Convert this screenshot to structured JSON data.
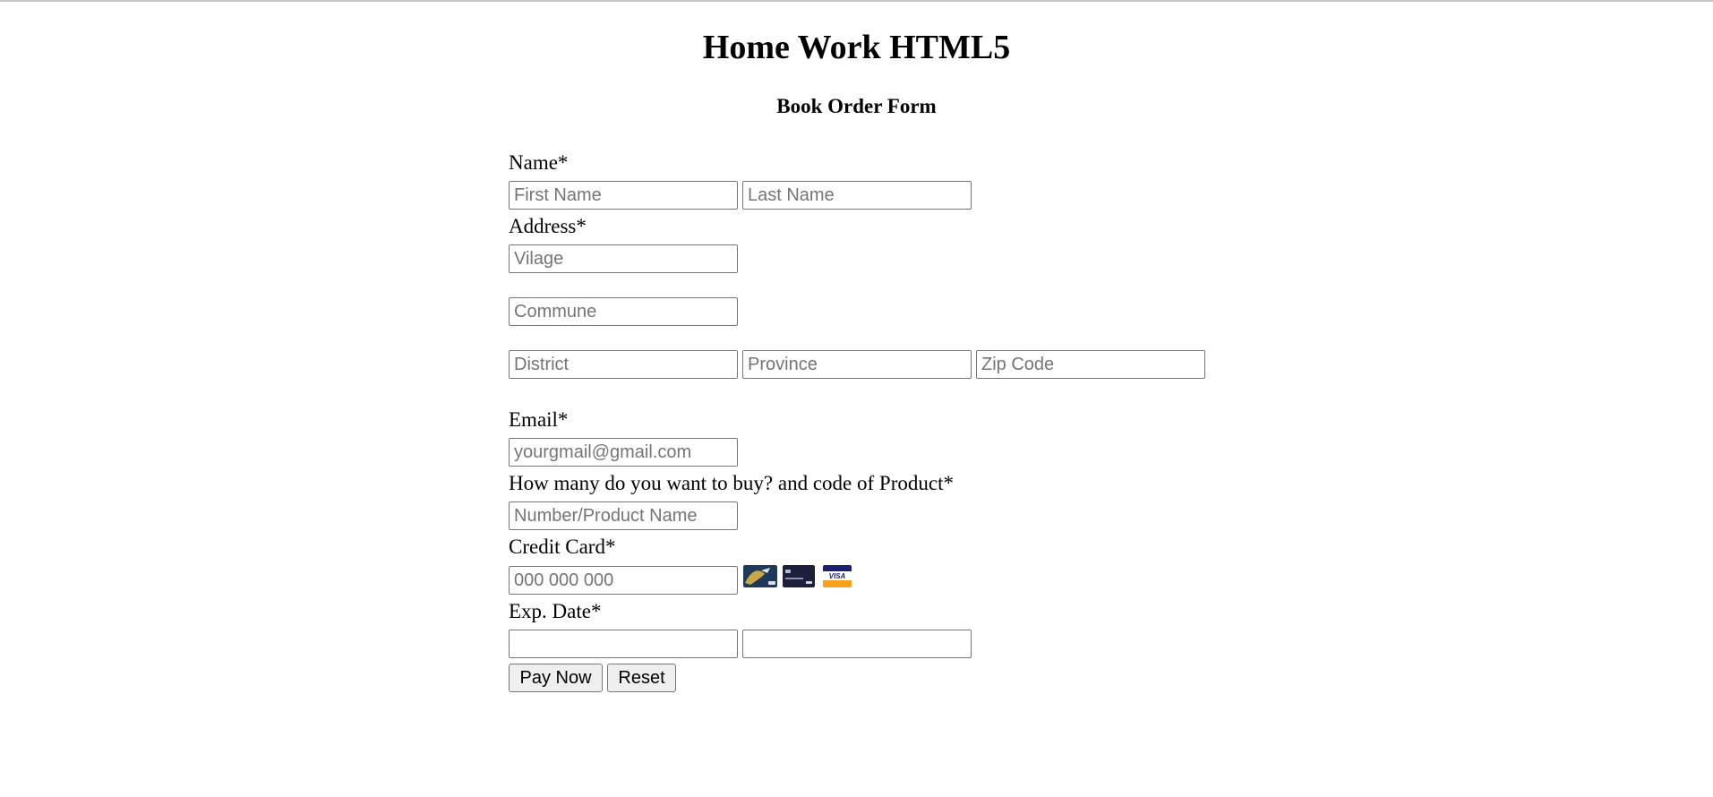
{
  "page": {
    "title": "Home Work HTML5",
    "form_title": "Book Order Form"
  },
  "name": {
    "label": "Name*",
    "first_placeholder": "First Name",
    "last_placeholder": "Last Name"
  },
  "address": {
    "label": "Address*",
    "village_placeholder": "Vilage",
    "commune_placeholder": "Commune",
    "district_placeholder": "District",
    "province_placeholder": "Province",
    "zip_placeholder": "Zip Code"
  },
  "email": {
    "label": "Email*",
    "placeholder": "yourgmail@gmail.com"
  },
  "quantity": {
    "label": "How many do you want to buy? and code of Product*",
    "placeholder": "Number/Product Name"
  },
  "credit_card": {
    "label": "Credit Card*",
    "placeholder": "000 000 000",
    "card_icons": [
      "gold-card-icon",
      "dark-card-icon",
      "visa-card-icon"
    ],
    "visa_text": "VISA"
  },
  "exp_date": {
    "label": "Exp. Date*",
    "month_value": "",
    "year_value": ""
  },
  "buttons": {
    "pay_label": "Pay Now",
    "reset_label": "Reset"
  },
  "colors": {
    "border": "#767676",
    "button_bg": "#efefef",
    "placeholder": "#757575",
    "visa_blue": "#1a1f71",
    "visa_orange": "#f7a21b"
  }
}
